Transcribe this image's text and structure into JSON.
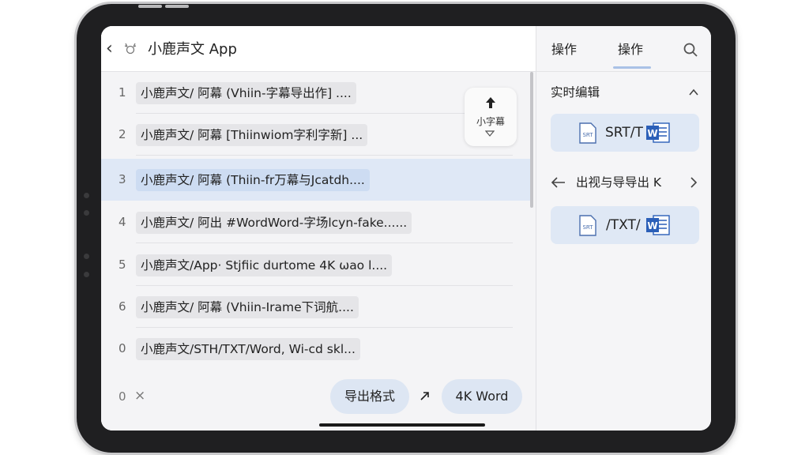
{
  "app": {
    "title": "小鹿声文 App"
  },
  "list": {
    "rows": [
      {
        "num": "1",
        "text": "小鹿声文/ 阿幕 (Vhiin-字幕导出作] ...."
      },
      {
        "num": "2",
        "text": "小鹿声文/ 阿幕 [Thiinwiom字利字新] ..."
      },
      {
        "num": "3",
        "text": "小鹿声文/ 阿幕 (Thiin-fr万幕与Jcatdh...."
      },
      {
        "num": "4",
        "text": "小鹿声文/ 阿出 #WordWord-字场lcyn-fake......"
      },
      {
        "num": "5",
        "text": "小鹿声文/App· Stjfiic durtome 4K ωao l...."
      },
      {
        "num": "6",
        "text": "小鹿声文/ 阿幕 (Vhiin-Irame下词航...."
      },
      {
        "num": "0",
        "text": "小鹿声文/STH/TXT/Word, Wi-cd skl..."
      }
    ]
  },
  "floating": {
    "label": "小字幕"
  },
  "bottom": {
    "count": "0",
    "close_icon": "×",
    "export_label": "导出格式",
    "arrow_glyph": "↗",
    "word_label": "4K Word"
  },
  "right": {
    "tab1": "操作",
    "tab2": "操作",
    "section_title": "实时编辑",
    "card1_text": "SRT/T",
    "nav_label": "出视与导导出 K",
    "card2_text": "/TXT/",
    "srt_icon_text": "SRT",
    "word_icon_text": "W"
  },
  "colors": {
    "accent": "#3a6fc8",
    "selected_row": "#dfe8f6",
    "pill": "#dde6f3",
    "word_blue": "#2b5fb8"
  }
}
